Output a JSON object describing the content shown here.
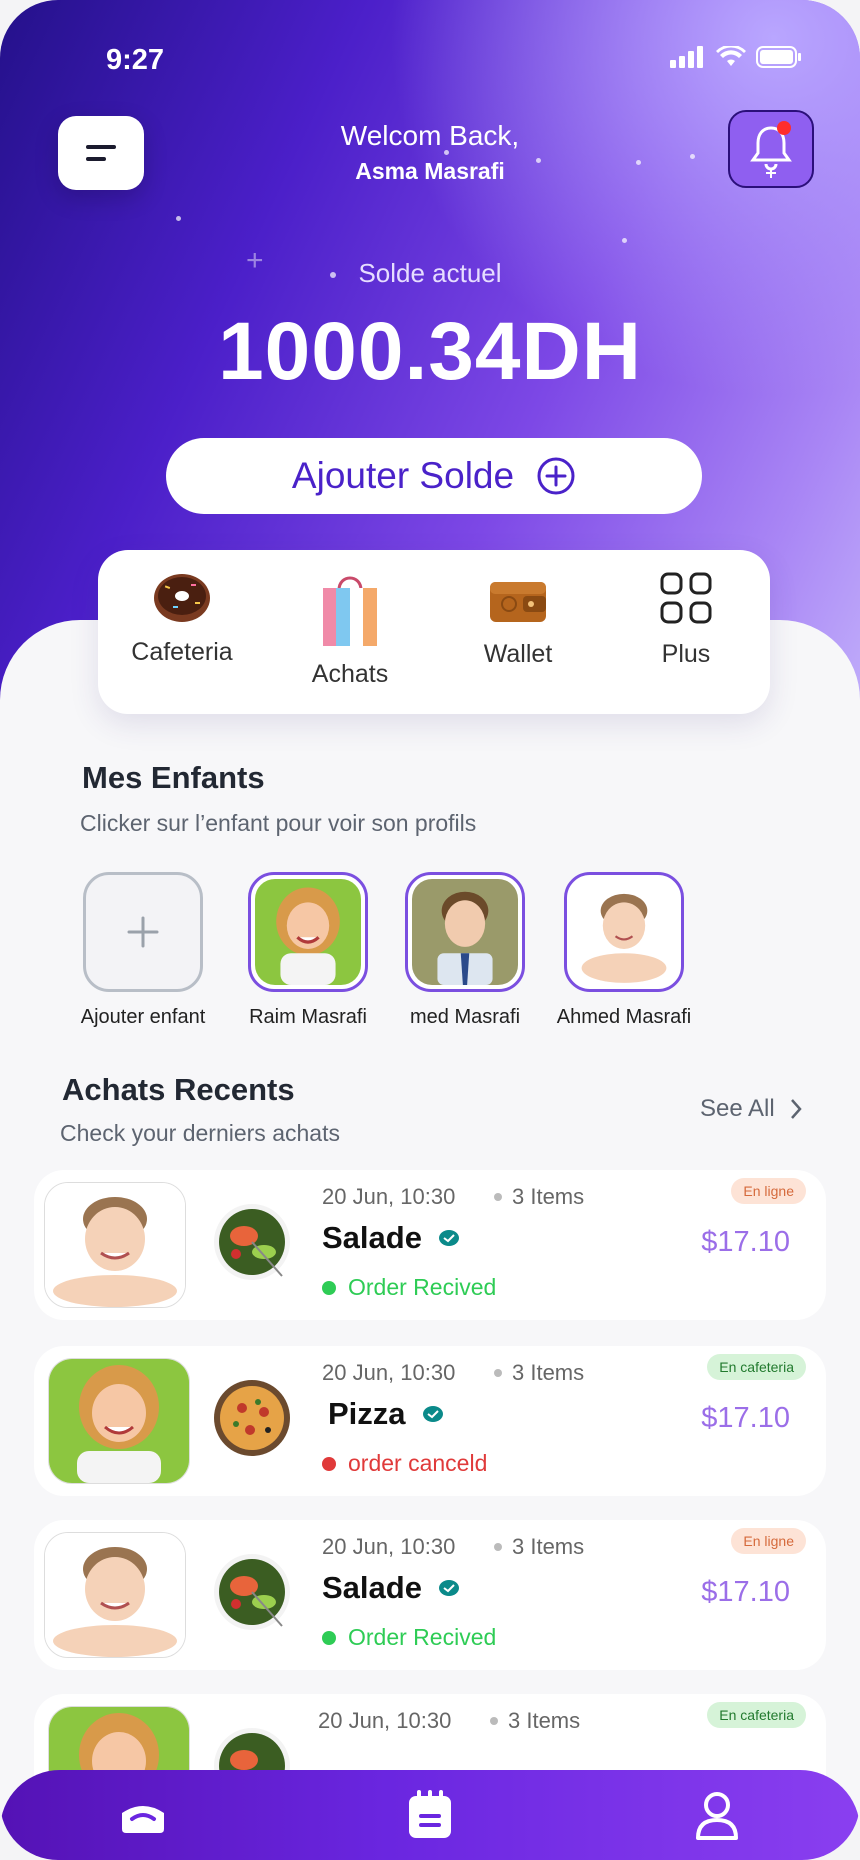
{
  "status_bar": {
    "time": "9:27"
  },
  "header": {
    "welcome_line": "Welcom Back,",
    "user_name": "Asma Masrafi"
  },
  "balance": {
    "label": "Solde actuel",
    "amount": "1000.34DH",
    "add_button_label": "Ajouter Solde"
  },
  "quick_actions": [
    {
      "label": "Cafeteria",
      "icon": "donut-icon"
    },
    {
      "label": "Achats",
      "icon": "shopping-bag-icon"
    },
    {
      "label": "Wallet",
      "icon": "wallet-icon"
    },
    {
      "label": "Plus",
      "icon": "grid-icon"
    }
  ],
  "children_section": {
    "title": "Mes Enfants",
    "subtitle": "Clicker sur l’enfant pour voir son profils",
    "add_label": "Ajouter enfant",
    "children": [
      {
        "name": "Raim Masrafi"
      },
      {
        "name": "med Masrafi"
      },
      {
        "name": "Ahmed Masrafi"
      }
    ]
  },
  "recent_section": {
    "title": "Achats Recents",
    "subtitle": "Check your derniers achats",
    "see_all": "See All"
  },
  "orders": [
    {
      "date": "20 Jun, 10:30",
      "items": "3 Items",
      "name": "Salade",
      "status": "Order Recived",
      "status_color": "#2ecc55",
      "price": "$17.10",
      "tag": "En ligne",
      "child": "boy",
      "food": "salad"
    },
    {
      "date": "20 Jun, 10:30",
      "items": "3 Items",
      "name": "Pizza",
      "status": "order canceld",
      "status_color": "#e03a3a",
      "price": "$17.10",
      "tag": "En cafeteria",
      "child": "girl",
      "food": "pizza"
    },
    {
      "date": "20 Jun, 10:30",
      "items": "3 Items",
      "name": "Salade",
      "status": "Order Recived",
      "status_color": "#2ecc55",
      "price": "$17.10",
      "tag": "En ligne",
      "child": "boy",
      "food": "salad"
    },
    {
      "date": "20 Jun, 10:30",
      "items": "3 Items",
      "tag": "En cafeteria",
      "child": "girl",
      "food": "salad"
    }
  ],
  "colors": {
    "accent": "#5b2bd6",
    "price": "#9b6ee8",
    "received": "#2ecc55",
    "canceled": "#e03a3a"
  },
  "bottom_nav": [
    {
      "icon": "home-icon"
    },
    {
      "icon": "calendar-icon"
    },
    {
      "icon": "profile-icon"
    }
  ]
}
